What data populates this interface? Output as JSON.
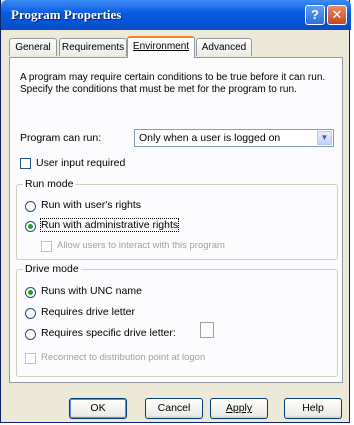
{
  "window": {
    "title": "Program Properties"
  },
  "titlebar": {
    "help_glyph": "?",
    "close_glyph": "✕"
  },
  "tabs": [
    {
      "label": "General",
      "active": false
    },
    {
      "label": "Requirements",
      "active": false
    },
    {
      "label": "Environment",
      "active": true
    },
    {
      "label": "Advanced",
      "active": false
    }
  ],
  "environment": {
    "description": "A program may require certain conditions to be true before it can run. Specify the conditions that must be met for the program to run.",
    "program_can_run_label": "Program can run:",
    "program_can_run_value": "Only when a user is logged on",
    "user_input_label": "User input required",
    "run_mode": {
      "title": "Run mode",
      "option_user_rights": "Run with user's rights",
      "option_admin_rights": "Run with administrative rights",
      "allow_users_label": "Allow users to interact with this program"
    },
    "drive_mode": {
      "title": "Drive mode",
      "option_unc": "Runs with UNC name",
      "option_drive_letter": "Requires drive letter",
      "option_specific_letter": "Requires specific drive letter:",
      "reconnect_label": "Reconnect to distribution point at logon"
    }
  },
  "buttons": {
    "ok": "OK",
    "cancel": "Cancel",
    "apply": "Apply",
    "help": "Help"
  },
  "colors": {
    "titlebar": "#0a5ae0",
    "active_tab_accent": "#e68b2c",
    "radio_dot": "#21a121"
  },
  "icons": {
    "help": "question-mark",
    "close": "x-mark",
    "dropdown": "chevron-down"
  }
}
